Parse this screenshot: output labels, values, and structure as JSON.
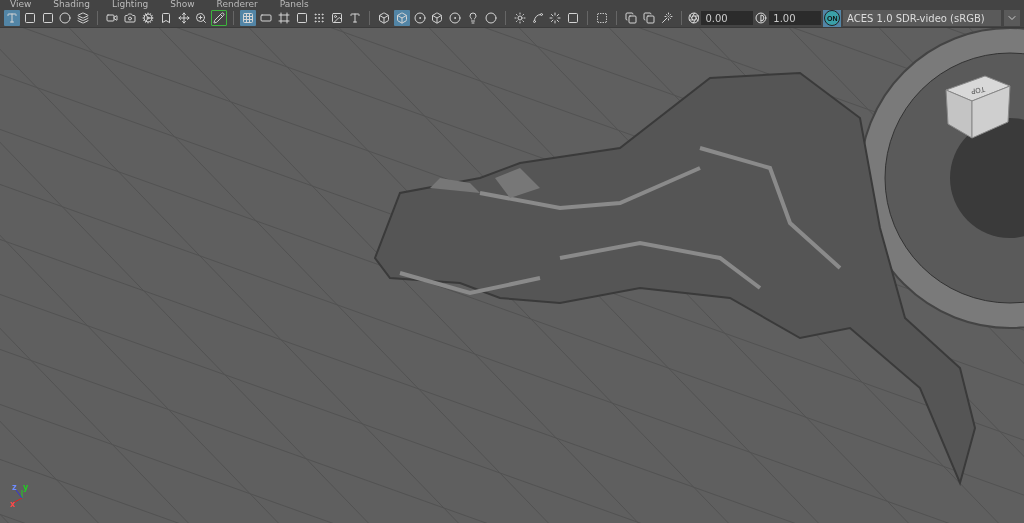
{
  "menu": [
    "View",
    "Shading",
    "Lighting",
    "Show",
    "Renderer",
    "Panels"
  ],
  "toolbar": {
    "groups": [
      [
        {
          "selected": true,
          "outlined": false
        },
        {
          "selected": false,
          "outlined": false
        },
        {
          "selected": false,
          "outlined": false
        },
        {
          "selected": false,
          "outlined": false
        },
        {
          "selected": false,
          "outlined": false
        }
      ],
      [
        {
          "selected": false,
          "outlined": false
        },
        {
          "selected": false,
          "outlined": false
        },
        {
          "selected": false,
          "outlined": false
        },
        {
          "selected": false,
          "outlined": false
        },
        {
          "selected": false,
          "outlined": false
        },
        {
          "selected": false,
          "outlined": false
        },
        {
          "selected": false,
          "outlined": true
        }
      ],
      [
        {
          "selected": true,
          "outlined": false
        },
        {
          "selected": false,
          "outlined": false
        },
        {
          "selected": false,
          "outlined": false
        },
        {
          "selected": false,
          "outlined": false
        },
        {
          "selected": false,
          "outlined": false
        },
        {
          "selected": false,
          "outlined": false
        },
        {
          "selected": false,
          "outlined": false
        }
      ],
      [
        {
          "selected": false,
          "outlined": false
        },
        {
          "selected": true,
          "outlined": false
        },
        {
          "selected": false,
          "outlined": false
        },
        {
          "selected": false,
          "outlined": false
        },
        {
          "selected": false,
          "outlined": false
        },
        {
          "selected": false,
          "outlined": false
        },
        {
          "selected": false,
          "outlined": false
        }
      ],
      [
        {
          "selected": false,
          "outlined": false
        },
        {
          "selected": false,
          "outlined": false
        },
        {
          "selected": false,
          "outlined": false
        },
        {
          "selected": false,
          "outlined": false
        }
      ],
      [
        {
          "selected": false,
          "outlined": false
        }
      ],
      [
        {
          "selected": false,
          "outlined": false
        },
        {
          "selected": false,
          "outlined": false
        },
        {
          "selected": false,
          "outlined": false
        }
      ]
    ],
    "exposure": "0.00",
    "gamma": "1.00",
    "color_management": {
      "label": "ON",
      "selected": true
    },
    "view_transform": "ACES 1.0 SDR-video (sRGB)"
  },
  "viewport": {
    "view_cube": {
      "label": "TOP"
    },
    "axes": {
      "x": "x",
      "y": "y",
      "z": "z"
    }
  }
}
